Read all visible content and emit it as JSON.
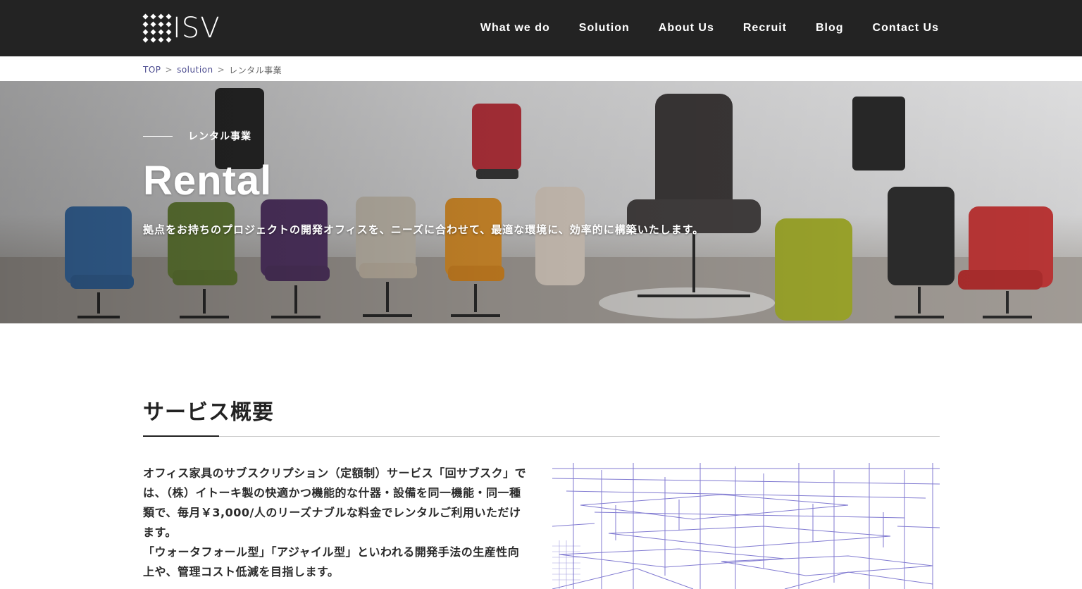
{
  "header": {
    "logo_text": "ISV",
    "nav": [
      {
        "label": "What we do"
      },
      {
        "label": "Solution"
      },
      {
        "label": "About Us"
      },
      {
        "label": "Recruit"
      },
      {
        "label": "Blog"
      },
      {
        "label": "Contact Us"
      }
    ]
  },
  "breadcrumb": {
    "items": [
      "TOP",
      "solution"
    ],
    "separator": ">",
    "current": "レンタル事業"
  },
  "hero": {
    "kicker": "レンタル事業",
    "title": "Rental",
    "lead": "拠点をお持ちのプロジェクトの開発オフィスを、ニーズに合わせて、最適な環境に、効率的に構築いたします。"
  },
  "section": {
    "title": "サービス概要",
    "paragraphs": [
      "オフィス家具のサブスクリプション（定額制）サービス「回サブスク」では、（株）イトーキ製の快適かつ機能的な什器・設備を同一機能・同一種類で、毎月￥3,000/人のリーズナブルな料金でレンタルご利用いただけます。",
      "「ウォータフォール型」「アジャイル型」といわれる開発手法の生産性向上や、管理コスト低減を目指します。"
    ]
  },
  "colors": {
    "header_bg": "#232323",
    "breadcrumb_link": "#4b4b8f",
    "illustration_line": "#6b63c9"
  }
}
